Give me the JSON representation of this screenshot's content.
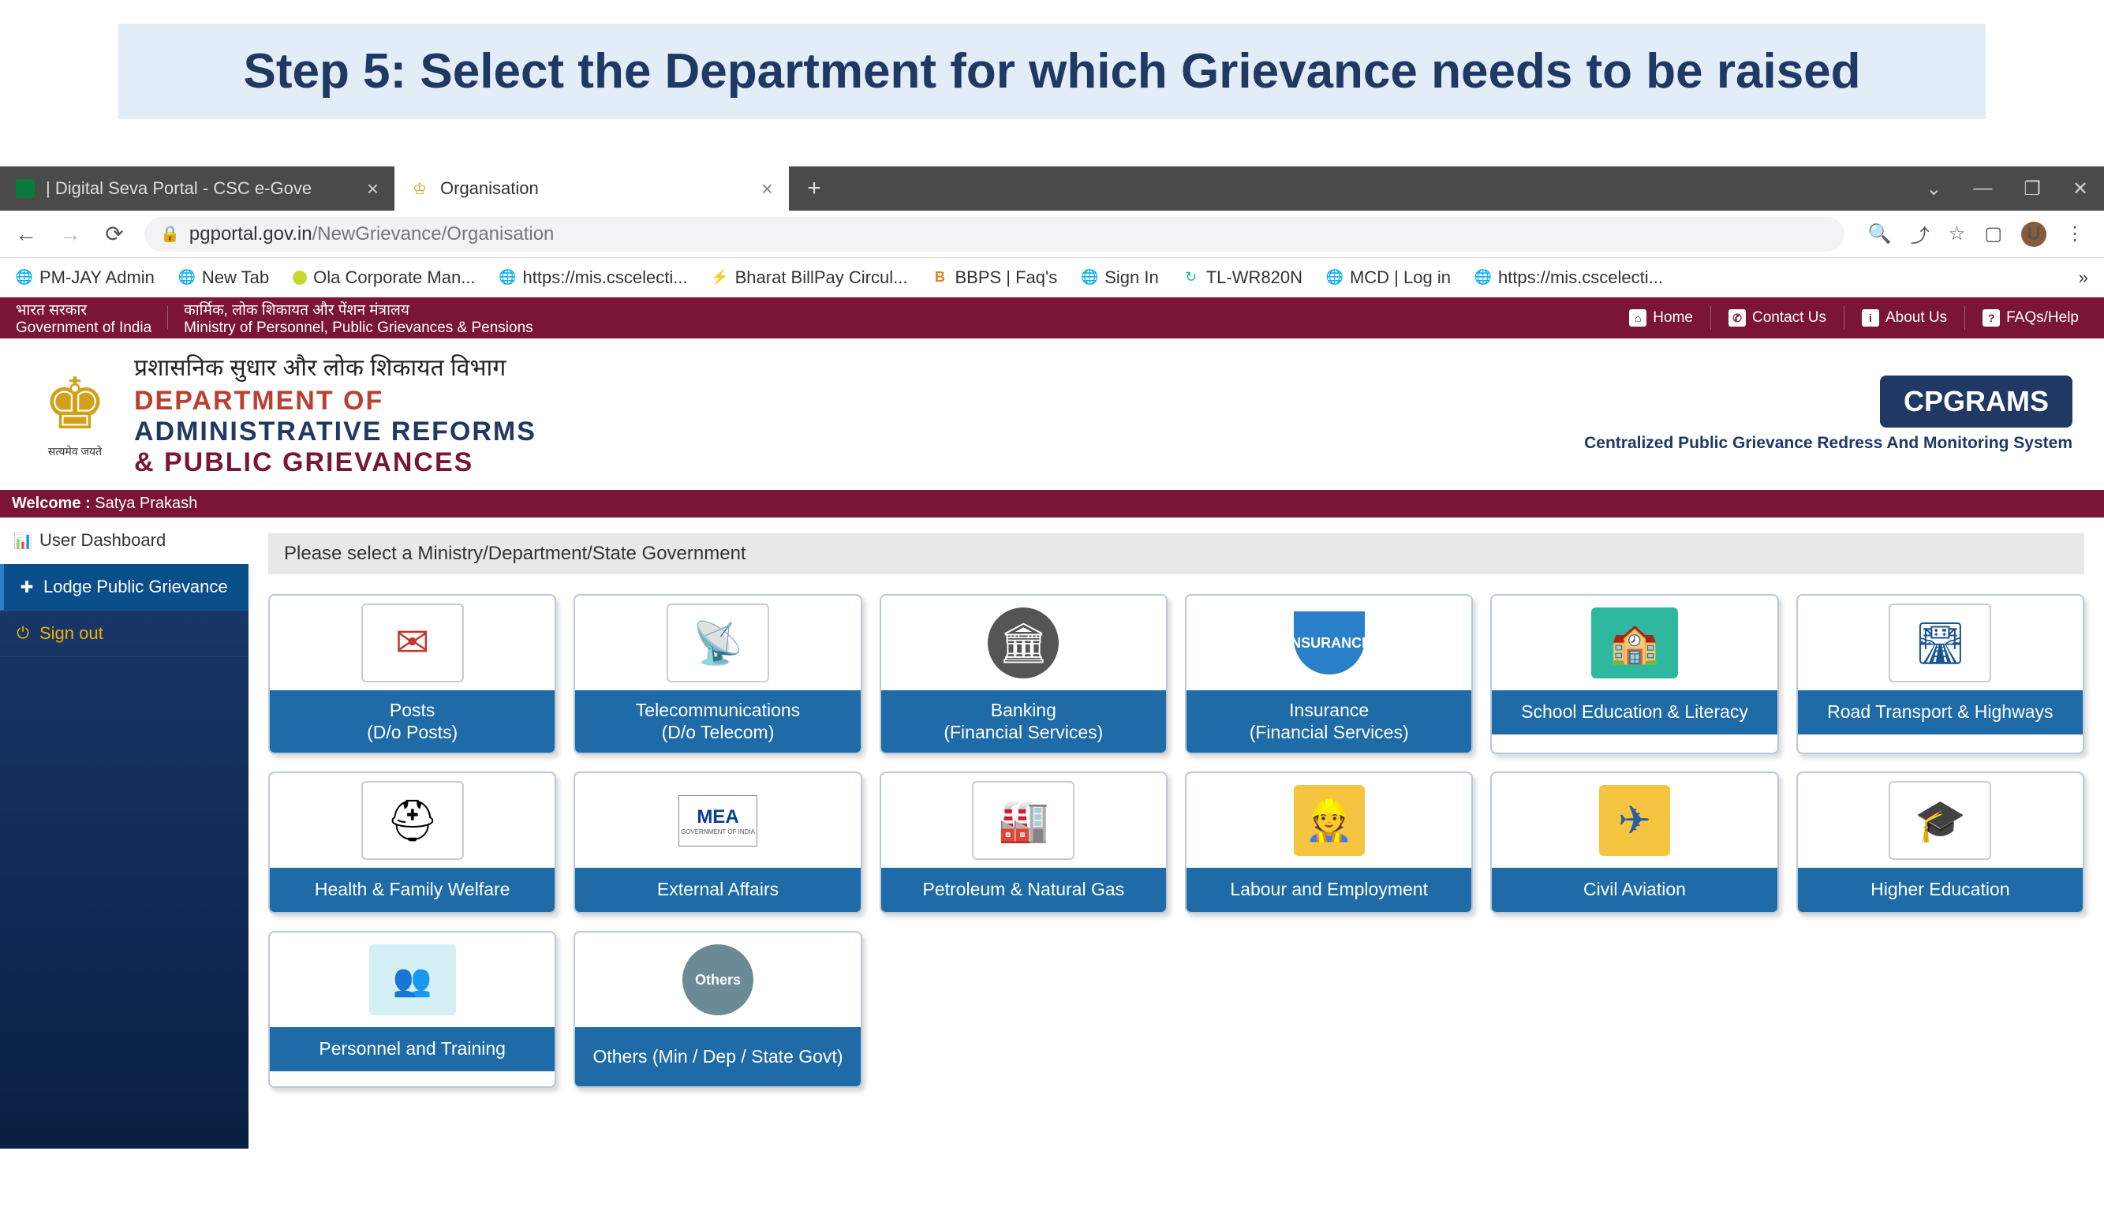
{
  "slide_title": "Step 5: Select the Department for which Grievance needs to be raised",
  "browser": {
    "tabs": [
      {
        "title": "| Digital Seva Portal - CSC e-Gove"
      },
      {
        "title": "Organisation"
      }
    ],
    "url_host": "pgportal.gov.in",
    "url_path": "/NewGrievance/Organisation",
    "avatar_letter": "U",
    "bookmarks": [
      "PM-JAY Admin",
      "New Tab",
      "Ola Corporate Man...",
      "https://mis.cscelecti...",
      "Bharat BillPay Circul...",
      "BBPS | Faq's",
      "Sign In",
      "TL-WR820N",
      "MCD | Log in",
      "https://mis.cscelecti..."
    ]
  },
  "gov_header": {
    "left_hindi1": "भारत सरकार",
    "left_hindi2": "कार्मिक, लोक शिकायत और पेंशन मंत्रालय",
    "left_en1": "Government of India",
    "left_en2": "Ministry of Personnel, Public Grievances & Pensions",
    "links": [
      "Home",
      "Contact Us",
      "About Us",
      "FAQs/Help"
    ]
  },
  "dept_banner": {
    "motto": "सत्यमेव जयते",
    "hindi": "प्रशासनिक सुधार और लोक शिकायत विभाग",
    "en_line1": "DEPARTMENT OF",
    "en_line2": "ADMINISTRATIVE REFORMS",
    "en_line3": "& PUBLIC GRIEVANCES",
    "cpgrams": "CPGRAMS",
    "cpgrams_sub": "Centralized Public Grievance Redress And Monitoring System"
  },
  "welcome": {
    "label": "Welcome :",
    "user": "Satya Prakash"
  },
  "sidebar": {
    "items": [
      "User Dashboard",
      "Lodge Public Grievance",
      "Sign out"
    ]
  },
  "content": {
    "prompt": "Please select a Ministry/Department/State Government",
    "cards": [
      {
        "line1": "Posts",
        "line2": "(D/o Posts)"
      },
      {
        "line1": "Telecommunications",
        "line2": "(D/o Telecom)"
      },
      {
        "line1": "Banking",
        "line2": "(Financial Services)"
      },
      {
        "line1": "Insurance",
        "line2": "(Financial Services)"
      },
      {
        "line1": "School Education & Literacy",
        "line2": ""
      },
      {
        "line1": "Road Transport & Highways",
        "line2": ""
      },
      {
        "line1": "Health & Family Welfare",
        "line2": ""
      },
      {
        "line1": "External Affairs",
        "line2": ""
      },
      {
        "line1": "Petroleum & Natural Gas",
        "line2": ""
      },
      {
        "line1": "Labour and Employment",
        "line2": ""
      },
      {
        "line1": "Civil Aviation",
        "line2": ""
      },
      {
        "line1": "Higher Education",
        "line2": ""
      },
      {
        "line1": "Personnel and Training",
        "line2": ""
      },
      {
        "line1": "Others (Min / Dep / State Govt)",
        "line2": ""
      }
    ],
    "insurance_text": "INSURANCE",
    "others_text": "Others"
  }
}
